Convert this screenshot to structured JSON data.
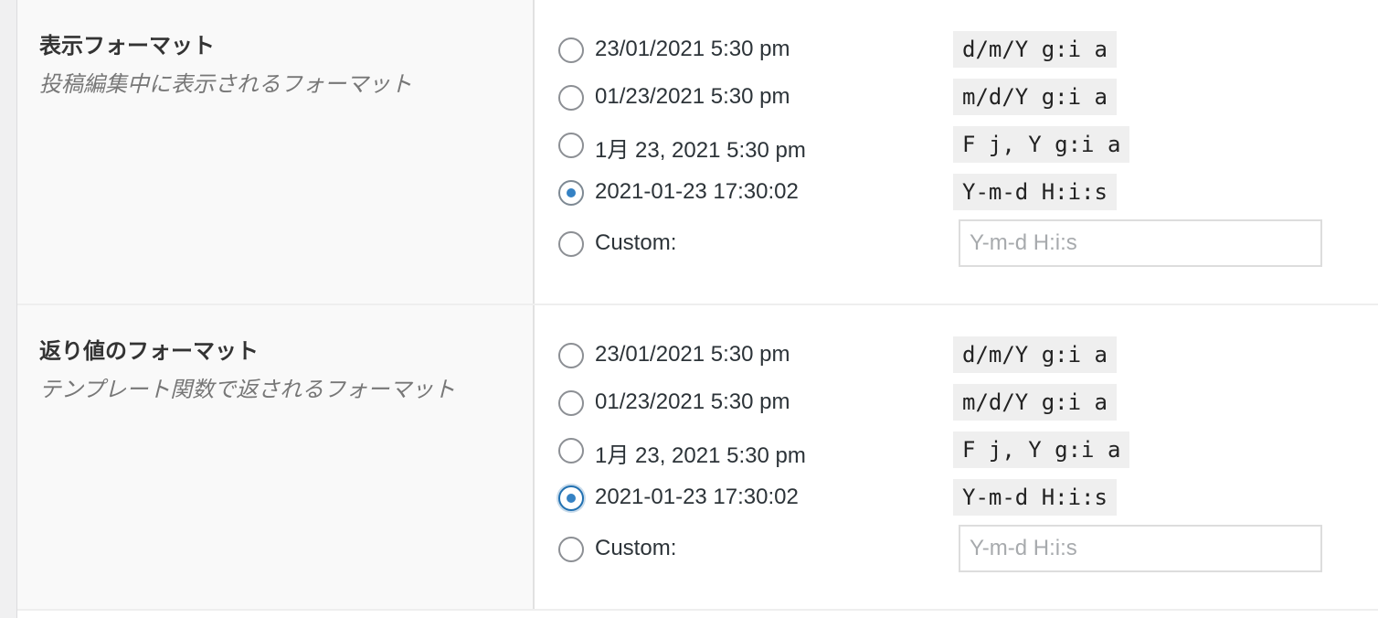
{
  "sections": [
    {
      "title": "表示フォーマット",
      "description": "投稿編集中に表示されるフォーマット",
      "options": [
        {
          "label": "23/01/2021 5:30 pm",
          "code": "d/m/Y g:i a",
          "checked": false
        },
        {
          "label": "01/23/2021 5:30 pm",
          "code": "m/d/Y g:i a",
          "checked": false
        },
        {
          "label": "1月 23, 2021 5:30 pm",
          "code": "F j, Y g:i a",
          "checked": false
        },
        {
          "label": "2021-01-23 17:30:02",
          "code": "Y-m-d H:i:s",
          "checked": true
        }
      ],
      "custom": {
        "label": "Custom:",
        "placeholder": "Y-m-d H:i:s",
        "value": ""
      }
    },
    {
      "title": "返り値のフォーマット",
      "description": "テンプレート関数で返されるフォーマット",
      "options": [
        {
          "label": "23/01/2021 5:30 pm",
          "code": "d/m/Y g:i a",
          "checked": false
        },
        {
          "label": "01/23/2021 5:30 pm",
          "code": "m/d/Y g:i a",
          "checked": false
        },
        {
          "label": "1月 23, 2021 5:30 pm",
          "code": "F j, Y g:i a",
          "checked": false
        },
        {
          "label": "2021-01-23 17:30:02",
          "code": "Y-m-d H:i:s",
          "checked": true
        }
      ],
      "custom": {
        "label": "Custom:",
        "placeholder": "Y-m-d H:i:s",
        "value": ""
      }
    }
  ],
  "colors": {
    "radio_dot": "#3582c4",
    "code_bg": "#efefef",
    "label_bg": "#f9f9f9"
  }
}
